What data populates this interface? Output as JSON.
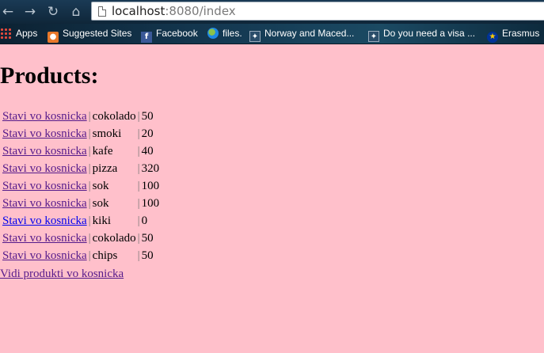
{
  "browser": {
    "url_host": "localhost",
    "url_rest": ":8080/index"
  },
  "bookmarks": [
    {
      "label": "Apps",
      "icon": "apps-grid-icon"
    },
    {
      "label": "Suggested Sites",
      "icon": "suggested-sites-icon"
    },
    {
      "label": "Facebook",
      "icon": "facebook-icon"
    },
    {
      "label": "files.",
      "icon": "globe-icon"
    },
    {
      "label": "Norway and Maced...",
      "icon": "norway-icon"
    },
    {
      "label": "Do you need a visa ...",
      "icon": "visa-icon"
    },
    {
      "label": "Erasmus",
      "icon": "eu-flag-icon"
    }
  ],
  "page": {
    "title": "Products:",
    "separator": "|",
    "add_label": "Stavi vo kosnicka",
    "products": [
      {
        "name": "cokolado",
        "price": "50"
      },
      {
        "name": "smoki",
        "price": "20"
      },
      {
        "name": "kafe",
        "price": "40"
      },
      {
        "name": "pizza",
        "price": "320"
      },
      {
        "name": "sok",
        "price": "100"
      },
      {
        "name": "sok",
        "price": "100"
      },
      {
        "name": "kiki",
        "price": "0"
      },
      {
        "name": "cokolado",
        "price": "50"
      },
      {
        "name": "chips",
        "price": "50"
      }
    ],
    "view_cart_label": "Vidi produkti vo kosnicka"
  }
}
